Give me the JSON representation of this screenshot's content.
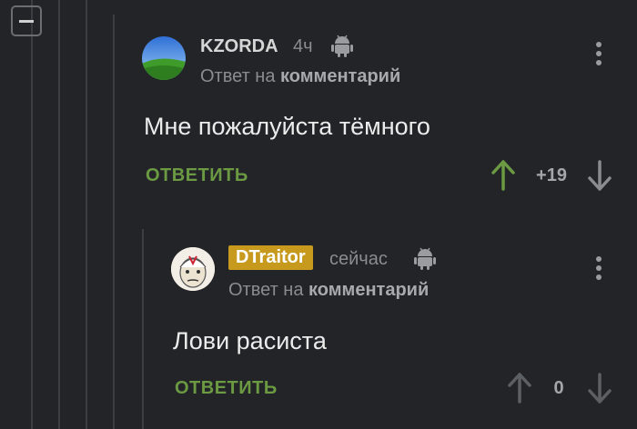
{
  "comment1": {
    "author": "KZORDA",
    "time": "4ч",
    "reply_prefix": "Ответ на",
    "reply_target": "комментарий",
    "text": "Мне пожалуйста тёмного",
    "reply_label": "ОТВЕТИТЬ",
    "score": "+19"
  },
  "comment2": {
    "author": "DTraitor",
    "time": "сейчас",
    "reply_prefix": "Ответ на",
    "reply_target": "комментарий",
    "text": "Лови расиста",
    "reply_label": "ОТВЕТИТЬ",
    "score": "0"
  },
  "colors": {
    "upvote_active": "#6b9a43",
    "reply_green": "#6b9a43",
    "badge": "#c79a1e"
  },
  "icons": [
    "collapse-icon",
    "android-icon",
    "kebab-menu-icon",
    "arrow-up-icon",
    "arrow-down-icon"
  ]
}
